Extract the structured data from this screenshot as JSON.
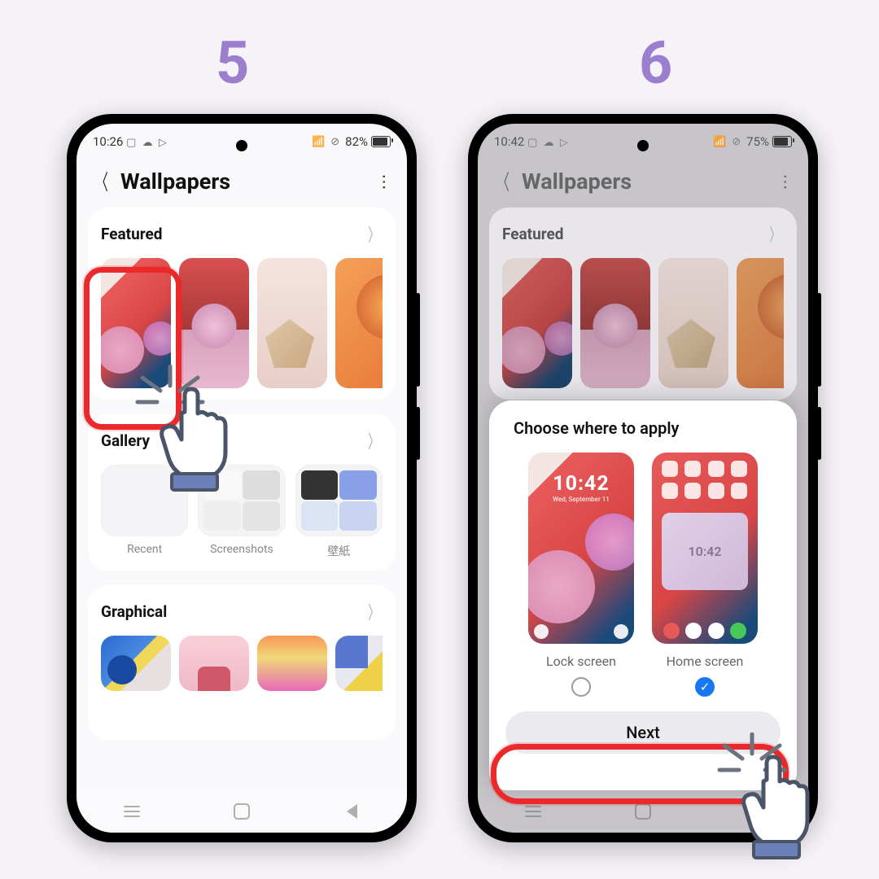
{
  "steps": {
    "five": "5",
    "six": "6"
  },
  "phone5": {
    "status": {
      "time": "10:26",
      "icons": "▢ ☁ ▷",
      "right_icons": "⊘",
      "battery_pct": "82%",
      "battery_fill": 82
    },
    "header": {
      "title": "Wallpapers"
    },
    "sections": {
      "featured": "Featured",
      "gallery": "Gallery",
      "graphical": "Graphical"
    },
    "gallery": {
      "recent": "Recent",
      "screenshots": "Screenshots",
      "wallpaper_jp": "壁紙"
    }
  },
  "phone6": {
    "status": {
      "time": "10:42",
      "icons": "▢ ☁ ▷",
      "right_icons": "⊘",
      "battery_pct": "75%",
      "battery_fill": 75
    },
    "header": {
      "title": "Wallpapers"
    },
    "featured": "Featured",
    "modal": {
      "title": "Choose where to apply",
      "lock": "Lock screen",
      "home": "Home screen",
      "lock_time": "10:42",
      "lock_date": "Wed, September 11",
      "home_widget": "10:42",
      "next": "Next"
    }
  }
}
